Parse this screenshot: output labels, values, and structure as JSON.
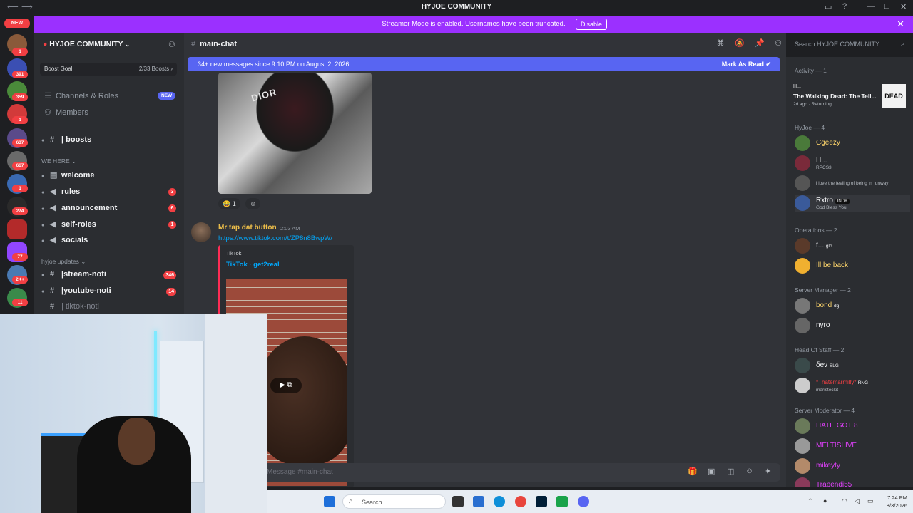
{
  "window": {
    "title": "HYJOE COMMUNITY",
    "back_icon": "arrow-left-icon",
    "forward_icon": "arrow-right-icon"
  },
  "banner": {
    "message": "Streamer Mode is enabled. Usernames have been truncated.",
    "button_label": "Disable",
    "background": "#9b30ff"
  },
  "server_rail": {
    "new_label": "NEW",
    "badges": [
      "1",
      "391",
      "359",
      "1",
      "637",
      "667",
      "1",
      "274",
      "",
      "77",
      "2K+",
      "11"
    ]
  },
  "sidebar": {
    "server_name": "HYJOE COMMUNITY",
    "boost_goal_label": "Boost Goal",
    "boost_progress_text": "2/33 Boosts",
    "boost_progress": 0.06,
    "nav": [
      {
        "label": "Channels & Roles",
        "badge": "NEW"
      },
      {
        "label": "Members"
      }
    ],
    "channels_top": [
      {
        "label": "| boosts"
      }
    ],
    "category_we_here": "WE HERE",
    "channels_we_here": [
      {
        "label": "welcome",
        "badge": ""
      },
      {
        "label": "rules",
        "badge": "3"
      },
      {
        "label": "announcement",
        "badge": "6"
      },
      {
        "label": "self-roles",
        "badge": "1"
      },
      {
        "label": "socials",
        "badge": ""
      }
    ],
    "category_updates": "hyjoe updates",
    "channels_updates": [
      {
        "label": "|stream-noti",
        "badge": "346"
      },
      {
        "label": "|youtube-noti",
        "badge": "14"
      },
      {
        "label": "| tiktok-noti",
        "badge": ""
      }
    ]
  },
  "chat": {
    "channel_name": "main-chat",
    "new_messages_text": "34+ new messages since 9:10 PM on August 2, 2026",
    "mark_as_read": "Mark As Read",
    "image_caption": "DIOR",
    "reaction_count": "1",
    "message": {
      "author": "Mr tap dat button",
      "time": "2:03 AM",
      "link": "https://www.tiktok.com/t/ZP8n8BwpW/",
      "embed_provider": "TikTok",
      "embed_title": "TikTok · get2real"
    },
    "composer_placeholder": "Message #main-chat"
  },
  "search": {
    "placeholder": "Search HYJOE COMMUNITY"
  },
  "members": {
    "activity_header": "Activity — 1",
    "activity": {
      "user": "H...",
      "title": "The Walking Dead: The Tell...",
      "meta": "2d ago",
      "status": "Returning",
      "thumb_text": "DEAD"
    },
    "groups": [
      {
        "header": "HyJoe — 4",
        "members": [
          {
            "name": "Cgeezy",
            "status": "",
            "color": "#ffd66b"
          },
          {
            "name": "H...",
            "status": "RPCS3",
            "color": "#f2f3f5"
          },
          {
            "name": "",
            "status": "i love the feeling of being in runway",
            "color": "#f2f3f5"
          },
          {
            "name": "Rxtro",
            "status": "God Bless You",
            "tag": "INDY",
            "color": "#f2f3f5"
          }
        ]
      },
      {
        "header": "Operations — 2",
        "members": [
          {
            "name": "f...",
            "status": "",
            "tag": "glo",
            "color": "#f2f3f5"
          },
          {
            "name": "Ill be back",
            "status": "",
            "color": "#ffd66b"
          }
        ]
      },
      {
        "header": "Server Manager — 2",
        "members": [
          {
            "name": "bond",
            "status": "",
            "tag": "dg",
            "color": "#ffd66b"
          },
          {
            "name": "nyro",
            "status": "",
            "color": "#f2f3f5"
          }
        ]
      },
      {
        "header": "Head Of Staff — 2",
        "members": [
          {
            "name": "δev",
            "status": "",
            "tag": "SLG",
            "color": "#f2f3f5"
          },
          {
            "name": "*Thatemarmilly*",
            "status": "maristeckit",
            "tag": "RNG",
            "color": "#f23f43"
          }
        ]
      },
      {
        "header": "Server Moderator — 4",
        "members": [
          {
            "name": "HATE GOT 8",
            "status": "",
            "color": "#e040fb"
          },
          {
            "name": "MELTISLIVE",
            "status": "",
            "color": "#e040fb"
          },
          {
            "name": "mikeyty",
            "status": "",
            "color": "#e040fb"
          },
          {
            "name": "Trapendj55",
            "status": "",
            "color": "#e040fb"
          }
        ]
      }
    ]
  },
  "taskbar": {
    "search_placeholder": "Search",
    "time": "7:24 PM",
    "date": "8/3/2026"
  }
}
